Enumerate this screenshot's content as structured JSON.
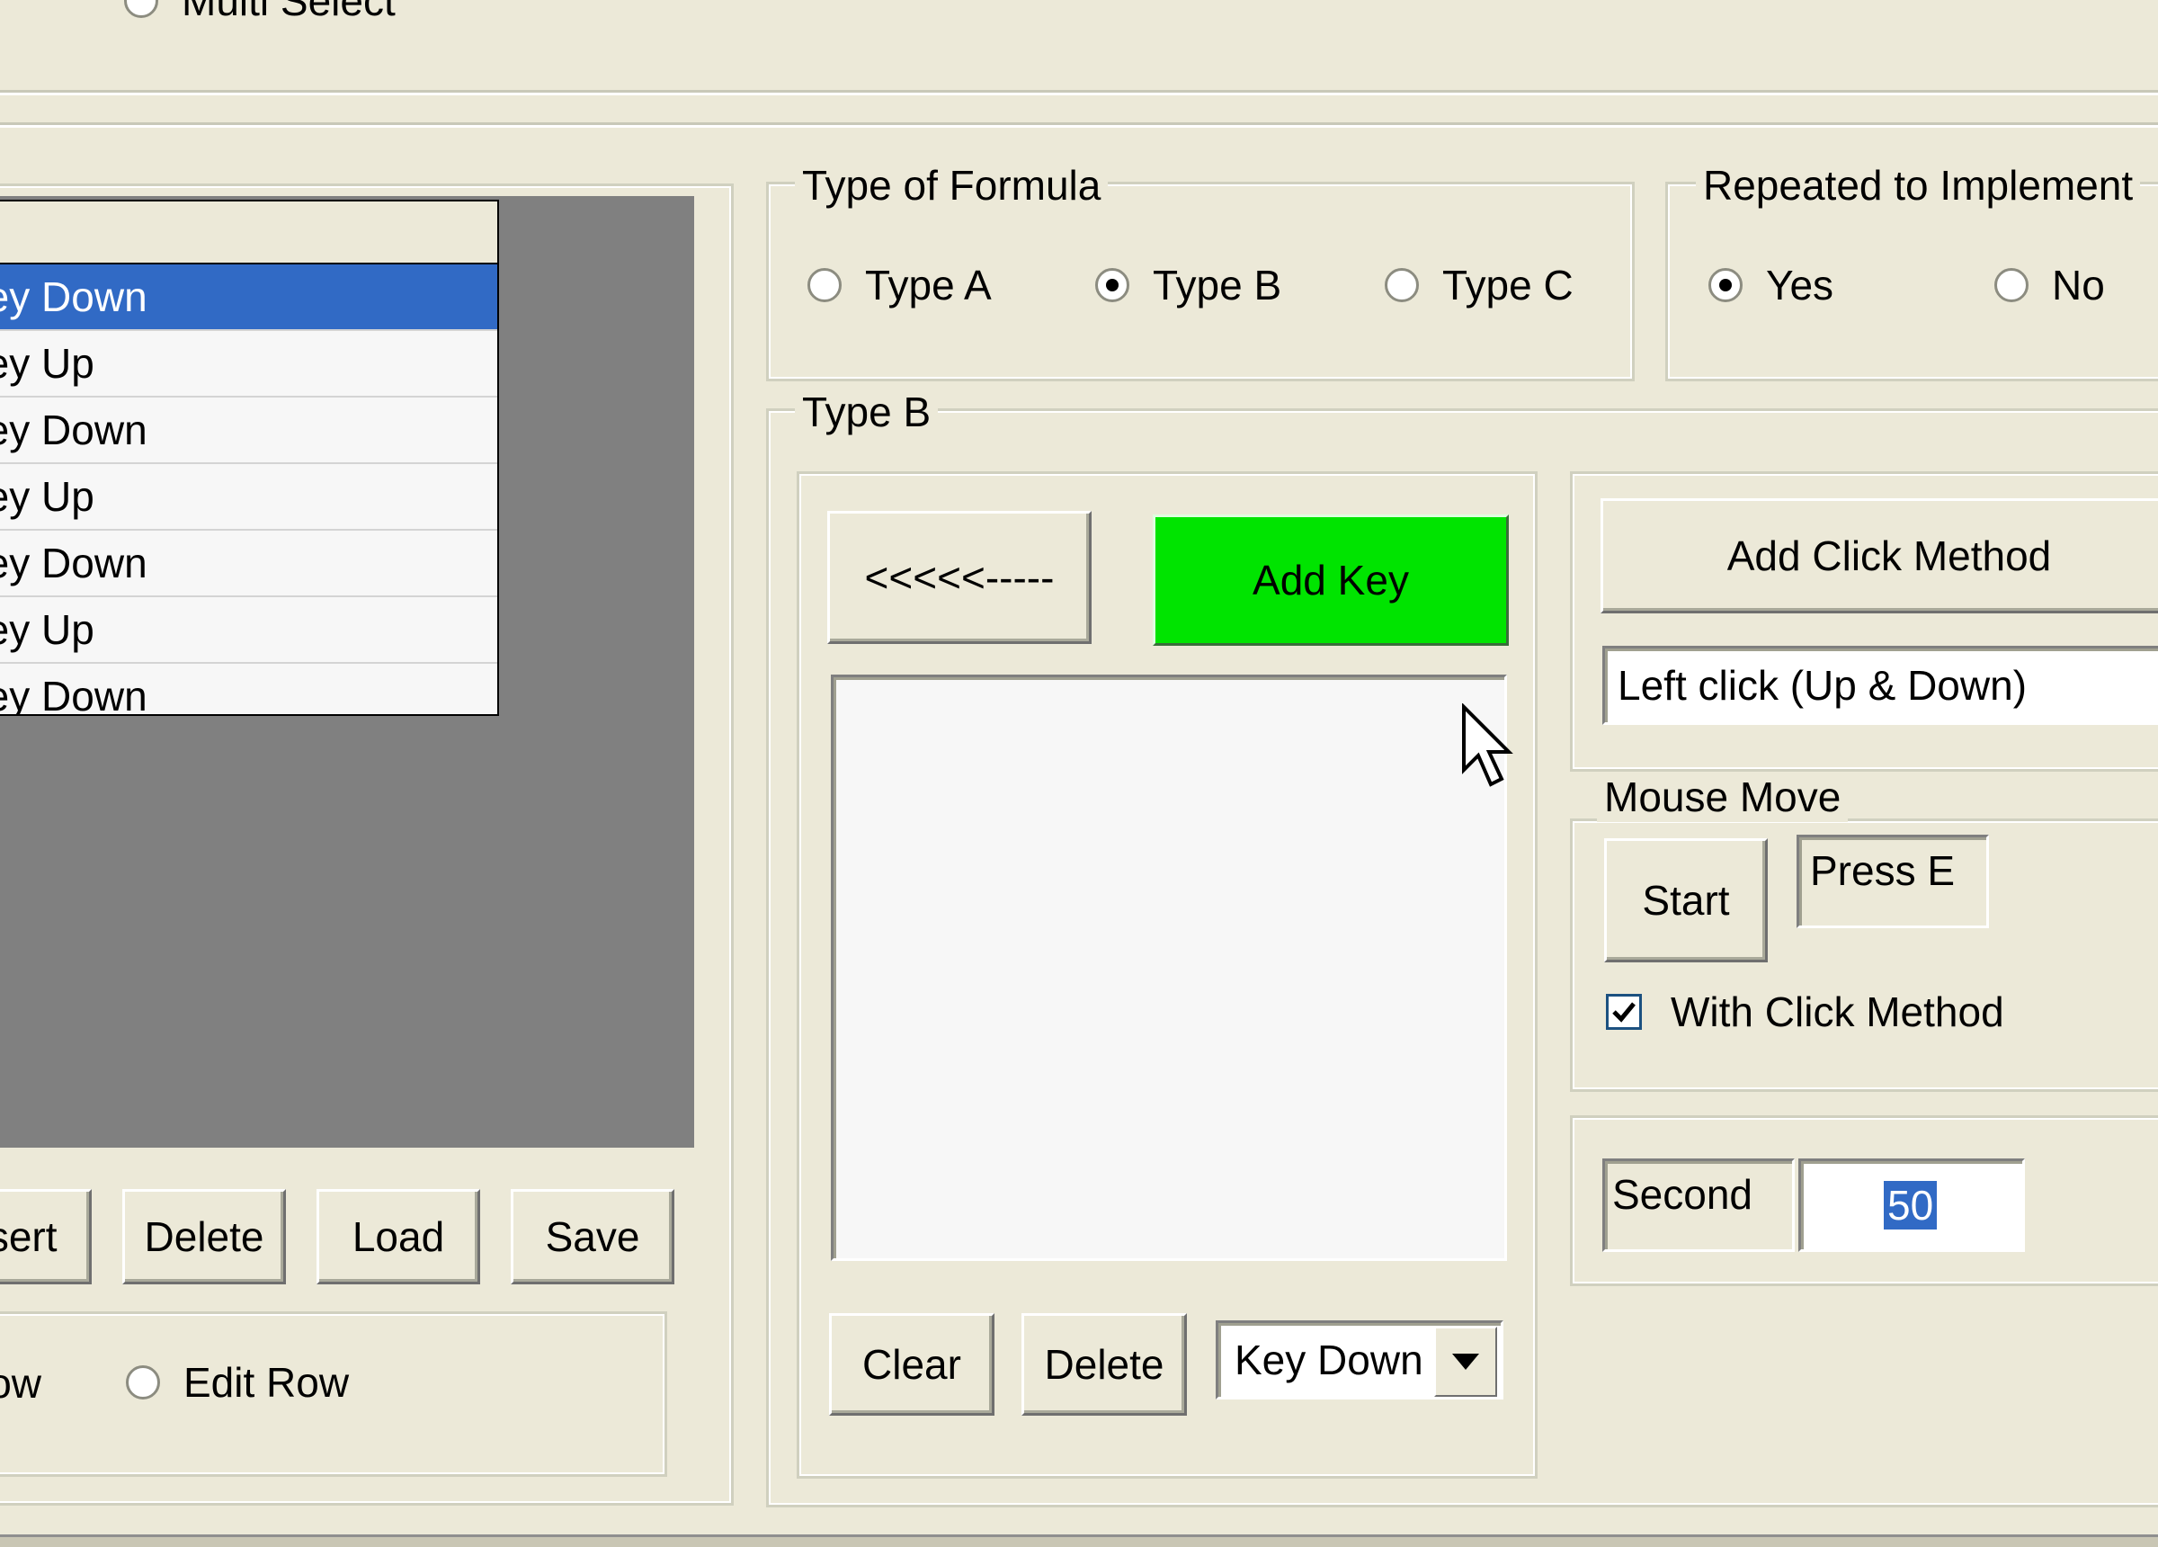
{
  "top": {
    "multi_select_label": "Multi Select"
  },
  "left_panel": {
    "list_rows": [
      "Key Down",
      "Key Up",
      "Key Down",
      "Key Up",
      "Key Down",
      "Key Up",
      "Key Down"
    ],
    "selected_index": 0,
    "buttons": {
      "insert": "Insert",
      "delete": "Delete",
      "load": "Load",
      "save": "Save"
    },
    "row_option_left": "Row",
    "edit_row_label": "Edit Row"
  },
  "type_of_formula": {
    "legend": "Type of Formula",
    "options": [
      "Type A",
      "Type B",
      "Type C"
    ],
    "selected": "Type B"
  },
  "repeated": {
    "legend": "Repeated to Implement",
    "options": [
      "Yes",
      "No"
    ],
    "selected": "Yes"
  },
  "type_b": {
    "legend": "Type B",
    "arrow_button": "<<<<<-----",
    "add_key_button": "Add Key",
    "clear_button": "Clear",
    "delete_button": "Delete",
    "key_select_value": "Key Down",
    "add_click_method_button": "Add Click Method",
    "click_method_value": "Left click (Up & Down)",
    "mouse_move": {
      "legend": "Mouse Move",
      "start_button": "Start",
      "press_hint": "Press E",
      "with_click_method_label": "With Click Method",
      "with_click_method_checked": true
    },
    "second_label": "Second",
    "second_value": "50"
  },
  "colors": {
    "selection": "#316ac5",
    "add_key_green": "#00e400",
    "face": "#ece9d8",
    "client_gray": "#808080"
  }
}
